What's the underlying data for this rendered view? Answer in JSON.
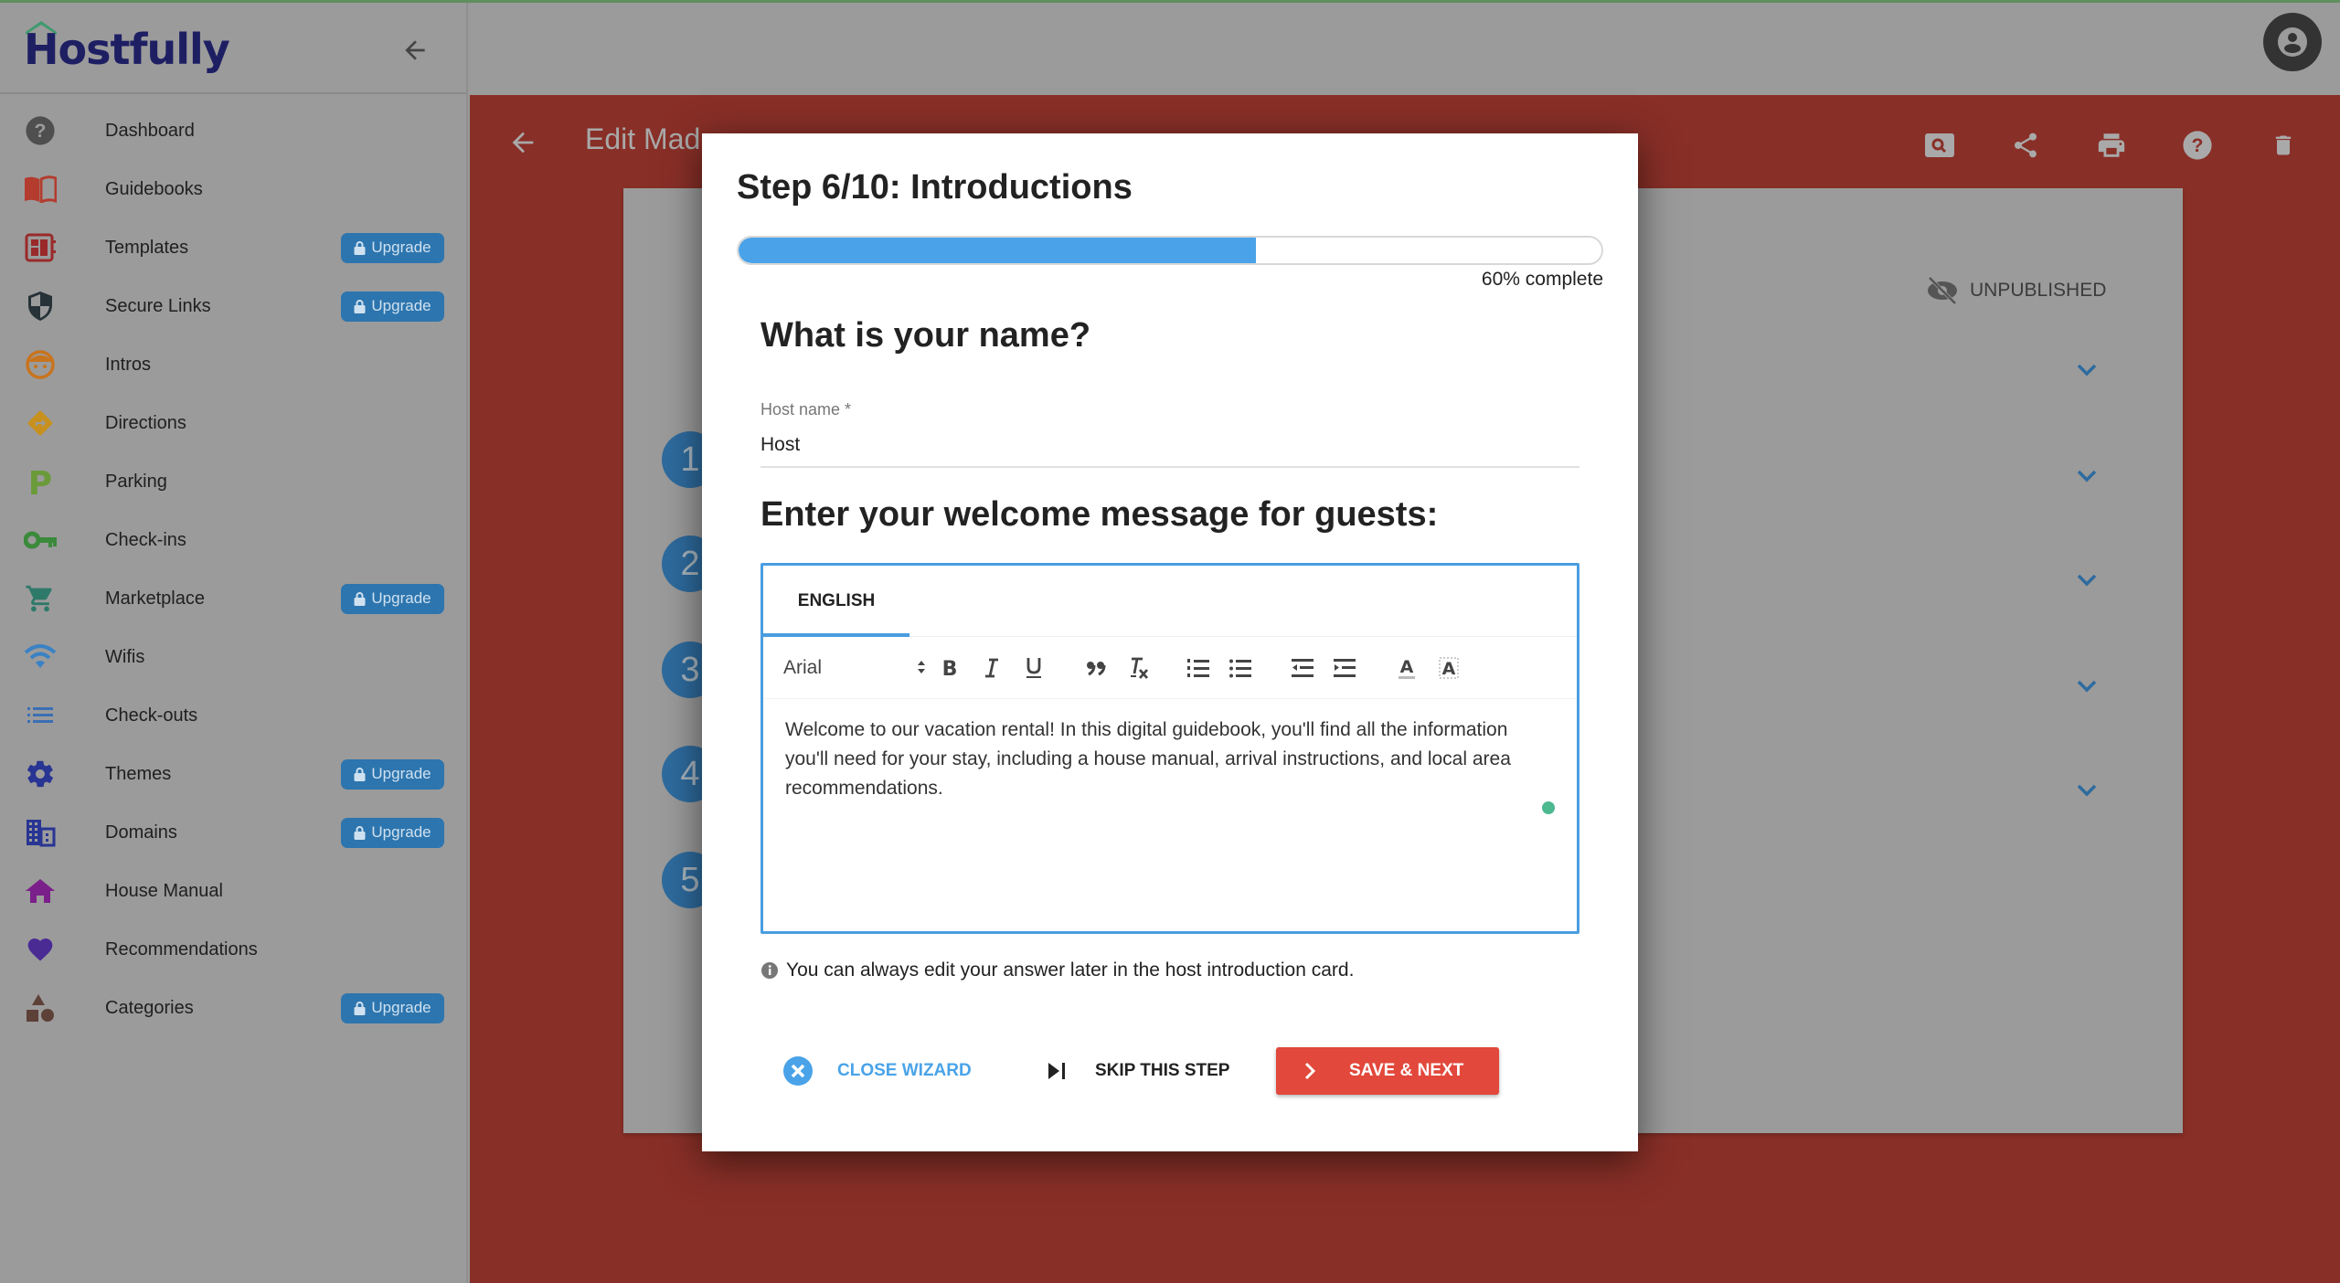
{
  "app": {
    "brand": "Hostfully",
    "colors": {
      "brand_navy": "#1e1f63",
      "brand_green": "#3f9a6e",
      "accent_blue": "#4aa3e8",
      "primary_red": "#e2483b",
      "header_red": "#882f27",
      "upgrade_blue": "#2d75ae",
      "status_dot": "#4cb990"
    }
  },
  "sidebar": {
    "collapse_icon": "arrow-left-icon",
    "items": [
      {
        "label": "Dashboard",
        "icon": "help-circle-icon",
        "upgrade": false
      },
      {
        "label": "Guidebooks",
        "icon": "open-book-icon",
        "upgrade": false
      },
      {
        "label": "Templates",
        "icon": "template-icon",
        "upgrade": true
      },
      {
        "label": "Secure Links",
        "icon": "shield-icon",
        "upgrade": true
      },
      {
        "label": "Intros",
        "icon": "face-icon",
        "upgrade": false
      },
      {
        "label": "Directions",
        "icon": "directions-icon",
        "upgrade": false
      },
      {
        "label": "Parking",
        "icon": "parking-icon",
        "upgrade": false
      },
      {
        "label": "Check-ins",
        "icon": "key-icon",
        "upgrade": false
      },
      {
        "label": "Marketplace",
        "icon": "cart-icon",
        "upgrade": true
      },
      {
        "label": "Wifis",
        "icon": "wifi-icon",
        "upgrade": false
      },
      {
        "label": "Check-outs",
        "icon": "list-icon",
        "upgrade": false
      },
      {
        "label": "Themes",
        "icon": "gear-icon",
        "upgrade": true
      },
      {
        "label": "Domains",
        "icon": "building-icon",
        "upgrade": true
      },
      {
        "label": "House Manual",
        "icon": "home-icon",
        "upgrade": false
      },
      {
        "label": "Recommendations",
        "icon": "heart-icon",
        "upgrade": false
      },
      {
        "label": "Categories",
        "icon": "shapes-icon",
        "upgrade": true
      }
    ],
    "upgrade_label": "Upgrade"
  },
  "topbar": {
    "avatar_icon": "account-circle-icon"
  },
  "main": {
    "back_icon": "arrow-left-icon",
    "title": "Edit Mad...",
    "actions": [
      {
        "icon": "preview-search-icon"
      },
      {
        "icon": "share-icon"
      },
      {
        "icon": "print-icon"
      },
      {
        "icon": "help-icon"
      },
      {
        "icon": "trash-icon"
      }
    ],
    "status": "UNPUBLISHED",
    "steps": [
      "1",
      "2",
      "3",
      "4",
      "5"
    ]
  },
  "wizard": {
    "title": "Step 6/10: Introductions",
    "progress": 60,
    "progress_label": "60% complete",
    "question_name": "What is your name?",
    "host_name_label": "Host name *",
    "host_name_value": "Host",
    "question_welcome": "Enter your welcome message for guests:",
    "editor": {
      "tabs": [
        {
          "label": "ENGLISH",
          "active": true
        }
      ],
      "font": "Arial",
      "toolbar": [
        "bold",
        "italic",
        "underline",
        "blockquote",
        "clear-format",
        "ordered-list",
        "bullet-list",
        "outdent",
        "indent",
        "text-color",
        "background-color"
      ],
      "content": "Welcome to our vacation rental! In this digital guidebook, you'll find all the information you'll need for your stay, including a house manual, arrival instructions, and local area recommendations."
    },
    "hint": "You can always edit your answer later in the host introduction card.",
    "close_label": "CLOSE WIZARD",
    "skip_label": "SKIP THIS STEP",
    "save_label": "SAVE & NEXT"
  }
}
